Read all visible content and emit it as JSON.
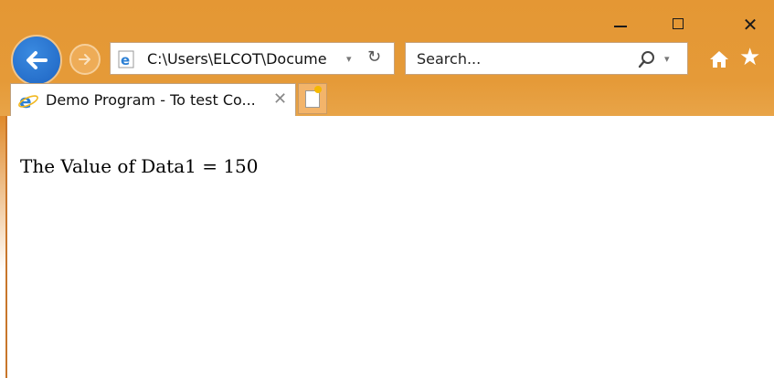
{
  "window": {
    "minimize_icon": "minimize-icon",
    "maximize_icon": "maximize-icon",
    "close_glyph": "✕"
  },
  "nav": {
    "back_icon": "arrow-left-icon",
    "forward_icon": "arrow-right-icon"
  },
  "address_bar": {
    "value": "C:\\Users\\ELCOT\\Docume",
    "dropdown_glyph": "▾",
    "refresh_glyph": "↻"
  },
  "search": {
    "placeholder": "Search...",
    "dropdown_glyph": "▾"
  },
  "toolbar": {
    "home_icon": "home-icon",
    "star_glyph": "★"
  },
  "tab": {
    "title": "Demo Program - To test Co...",
    "close_glyph": "✕"
  },
  "page": {
    "text": "The Value of Data1 = 150"
  },
  "colors": {
    "chrome": "#e59a38",
    "back_button": "#1e64c2"
  }
}
